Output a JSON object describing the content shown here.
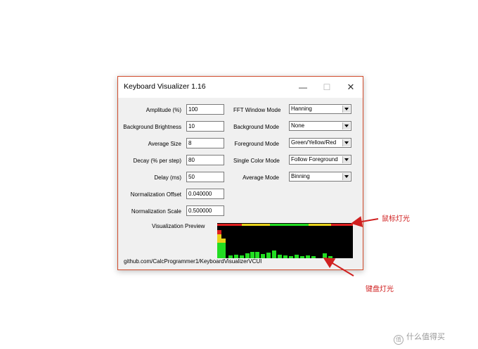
{
  "window": {
    "title": "Keyboard Visualizer 1.16",
    "controls": {
      "minimize": "—",
      "maximize": "☐",
      "close": "✕"
    }
  },
  "left_fields": [
    {
      "label": "Amplitude (%)",
      "value": "100"
    },
    {
      "label": "Background Brightness",
      "value": "10"
    },
    {
      "label": "Average Size",
      "value": "8"
    },
    {
      "label": "Decay (% per step)",
      "value": "80"
    },
    {
      "label": "Delay (ms)",
      "value": "50"
    },
    {
      "label": "Normalization Offset",
      "value": "0.040000"
    },
    {
      "label": "Normalization Scale",
      "value": "0.500000"
    }
  ],
  "right_dropdowns": [
    {
      "label": "FFT Window Mode",
      "value": "Hanning"
    },
    {
      "label": "Background Mode",
      "value": "None"
    },
    {
      "label": "Foreground Mode",
      "value": "Green/Yellow/Red"
    },
    {
      "label": "Single Color Mode",
      "value": "Follow Foreground"
    },
    {
      "label": "Average Mode",
      "value": "Binning"
    }
  ],
  "preview": {
    "label": "Visualization Preview",
    "colors": {
      "green": "#22dd22",
      "yellow": "#e8d21a",
      "red": "#e02020",
      "background": "#000000"
    }
  },
  "footer": "github.com/CalcProgrammer1/KeyboardVisualizerVCUI",
  "annotations": {
    "mouse_light": "鼠标灯光",
    "keyboard_light": "键盘灯光",
    "color": "#d02020"
  },
  "watermark": {
    "text": "什么值得买",
    "icon": "值"
  }
}
